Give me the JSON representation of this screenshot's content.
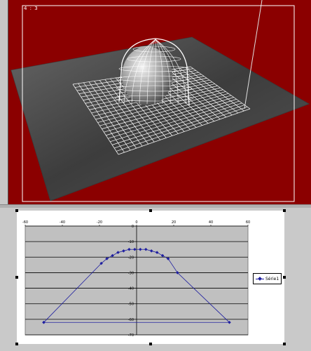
{
  "viewport": {
    "label": "4 : 3",
    "colors": {
      "background": "#8b0000",
      "ground": "#4a4a4a",
      "wire": "#ffffff"
    }
  },
  "chart_data": {
    "type": "scatter",
    "series": [
      {
        "name": "Série1",
        "color": "#1f1fa0",
        "x": [
          -50,
          -19,
          -16,
          -13,
          -10,
          -7,
          -4,
          -1,
          2,
          5,
          8,
          11,
          14,
          17,
          22,
          50,
          -50
        ],
        "y": [
          -62,
          -24,
          -21,
          -19,
          -17,
          -16,
          -15,
          -15,
          -15,
          -15,
          -16,
          -17,
          -19,
          -21,
          -30,
          -62,
          -62
        ]
      }
    ],
    "xlim": [
      -60,
      60
    ],
    "ylim": [
      -70,
      0
    ],
    "x_ticks": [
      "-60",
      "-40",
      "-20",
      "0",
      "20",
      "40",
      "60"
    ],
    "y_ticks": [
      "0",
      "-10",
      "-20",
      "-30",
      "-40",
      "-50",
      "-60",
      "-70"
    ],
    "grid": true,
    "legend": "right"
  }
}
